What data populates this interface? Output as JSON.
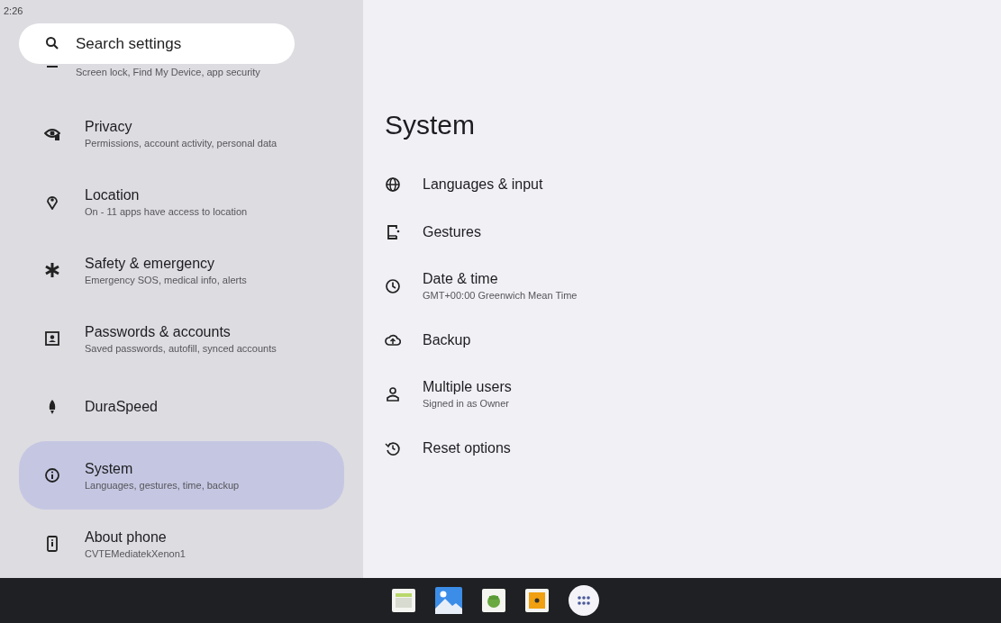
{
  "status_bar": {
    "time": "2:26"
  },
  "search": {
    "placeholder": "Search settings"
  },
  "sidebar": {
    "items": [
      {
        "subtitle": "Screen lock, Find My Device, app security",
        "selected": false
      },
      {
        "title": "Privacy",
        "subtitle": "Permissions, account activity, personal data",
        "selected": false
      },
      {
        "title": "Location",
        "subtitle": "On - 11 apps have access to location",
        "selected": false
      },
      {
        "title": "Safety & emergency",
        "subtitle": "Emergency SOS, medical info, alerts",
        "selected": false
      },
      {
        "title": "Passwords & accounts",
        "subtitle": "Saved passwords, autofill, synced accounts",
        "selected": false
      },
      {
        "title": "DuraSpeed",
        "selected": false
      },
      {
        "title": "System",
        "subtitle": "Languages, gestures, time, backup",
        "selected": true
      },
      {
        "title": "About phone",
        "subtitle": "CVTEMediatekXenon1",
        "selected": false
      }
    ]
  },
  "detail": {
    "title": "System",
    "items": [
      {
        "title": "Languages & input"
      },
      {
        "title": "Gestures"
      },
      {
        "title": "Date & time",
        "subtitle": "GMT+00:00 Greenwich Mean Time"
      },
      {
        "title": "Backup"
      },
      {
        "title": "Multiple users",
        "subtitle": "Signed in as Owner"
      },
      {
        "title": "Reset options"
      }
    ]
  }
}
